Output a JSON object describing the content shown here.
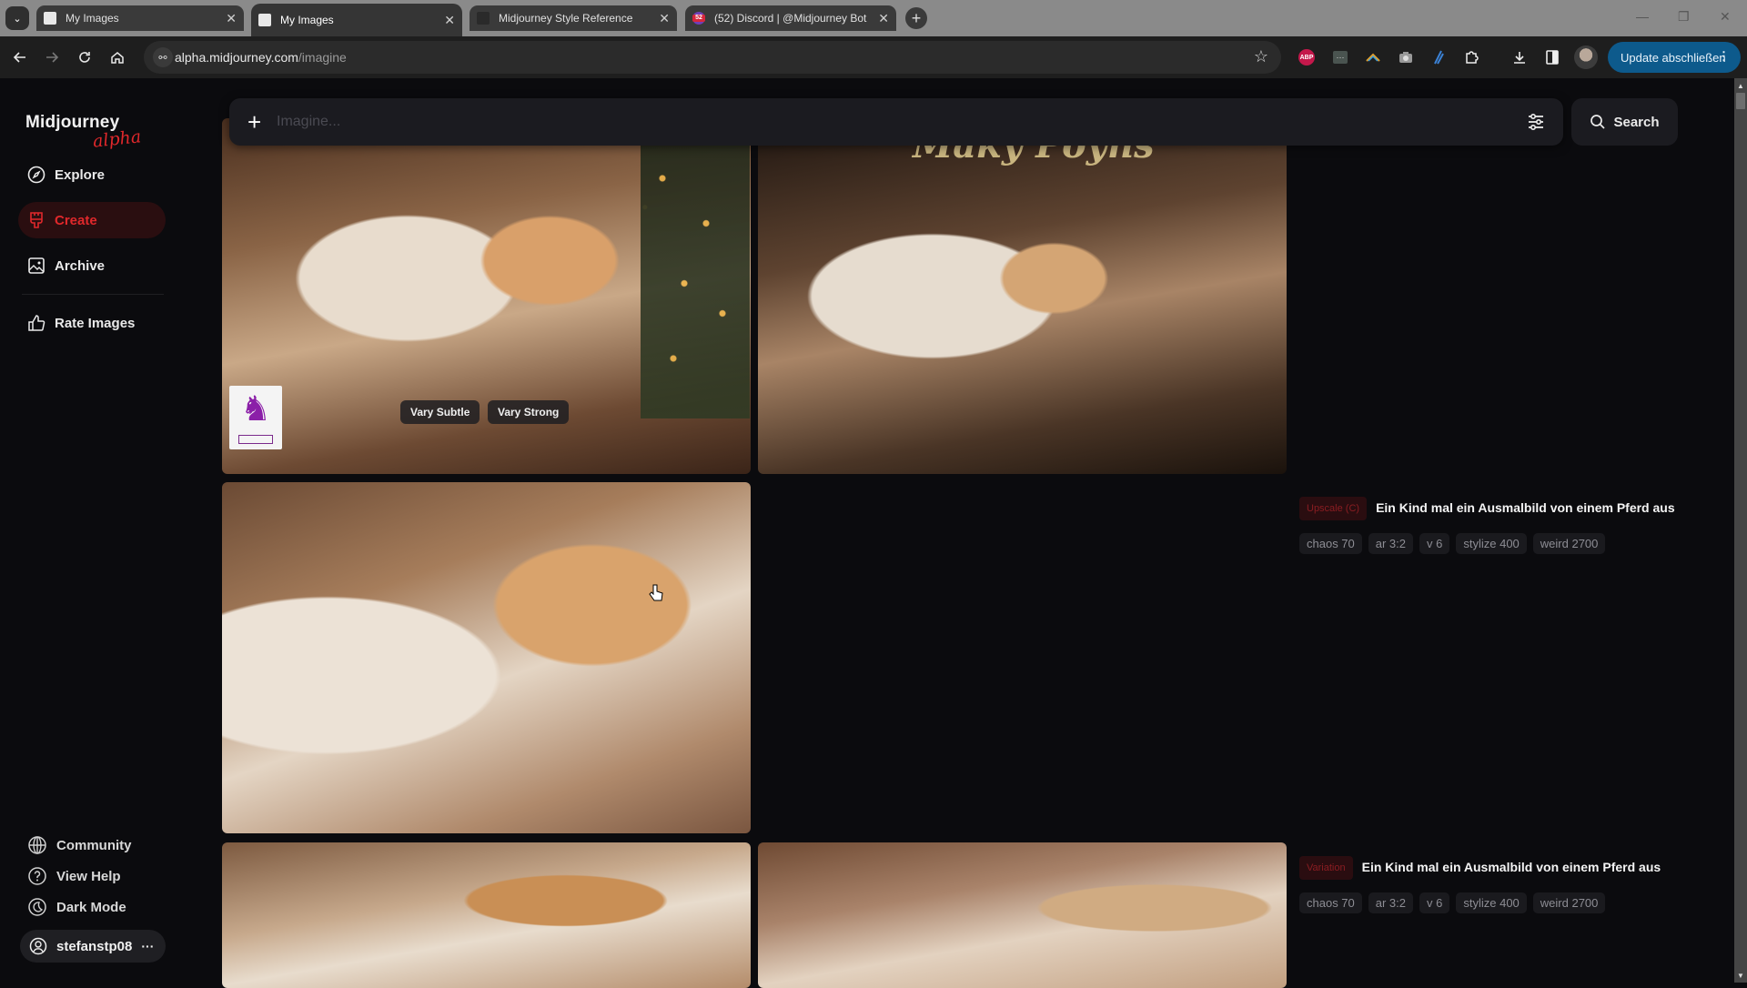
{
  "browser": {
    "tabs": [
      {
        "title": "My Images",
        "favicon": "midjourney-icon",
        "active": false
      },
      {
        "title": "My Images",
        "favicon": "midjourney-icon",
        "active": true
      },
      {
        "title": "Midjourney Style Reference",
        "favicon": "midjourney-icon",
        "active": false
      },
      {
        "title": "(52) Discord | @Midjourney Bot",
        "favicon": "discord-icon",
        "active": false
      }
    ],
    "tab_close_glyph": "✕",
    "new_tab_glyph": "+",
    "tab_list_glyph": "⌄",
    "window_controls": {
      "minimize": "—",
      "restore": "❐",
      "close": "✕"
    },
    "url_host": "alpha.midjourney.com",
    "url_path": "/imagine",
    "extensions": [
      "adblock-plus-icon",
      "extension-box-icon",
      "extension-rainbow-icon",
      "camera-icon",
      "pen-icon",
      "puzzle-icon"
    ],
    "abp_label": "ABP",
    "update_button": "Update abschließen"
  },
  "sidebar": {
    "brand": "Midjourney",
    "brand_tag": "alpha",
    "nav": [
      {
        "label": "Explore",
        "icon": "compass-icon",
        "active": false
      },
      {
        "label": "Create",
        "icon": "paintbrush-icon",
        "active": true
      },
      {
        "label": "Archive",
        "icon": "image-icon",
        "active": false
      },
      {
        "label": "Rate Images",
        "icon": "thumbs-up-icon",
        "active": false
      }
    ],
    "bottom": [
      {
        "label": "Community",
        "icon": "globe-icon"
      },
      {
        "label": "View Help",
        "icon": "help-icon"
      },
      {
        "label": "Dark Mode",
        "icon": "moon-icon"
      }
    ],
    "user": {
      "name": "stefanstp08",
      "menu_glyph": "···"
    }
  },
  "prompt": {
    "placeholder": "Imagine...",
    "value": "",
    "search_label": "Search"
  },
  "images": {
    "tile2_overlay_text": "Maky Poyns",
    "vary_subtle": "Vary Subtle",
    "vary_strong": "Vary Strong"
  },
  "jobs": [
    {
      "type": "Upscale (C)",
      "prompt": "Ein Kind mal ein Ausmalbild von einem Pferd aus",
      "params": [
        "chaos 70",
        "ar 3:2",
        "v 6",
        "stylize 400",
        "weird 2700"
      ]
    },
    {
      "type": "Variation",
      "prompt": "Ein Kind mal ein Ausmalbild von einem Pferd aus",
      "params": [
        "chaos 70",
        "ar 3:2",
        "v 6",
        "stylize 400",
        "weird 2700"
      ]
    }
  ],
  "colors": {
    "accent": "#e0282b",
    "background": "#0b0b0e",
    "update_button": "#0d5a8c"
  }
}
